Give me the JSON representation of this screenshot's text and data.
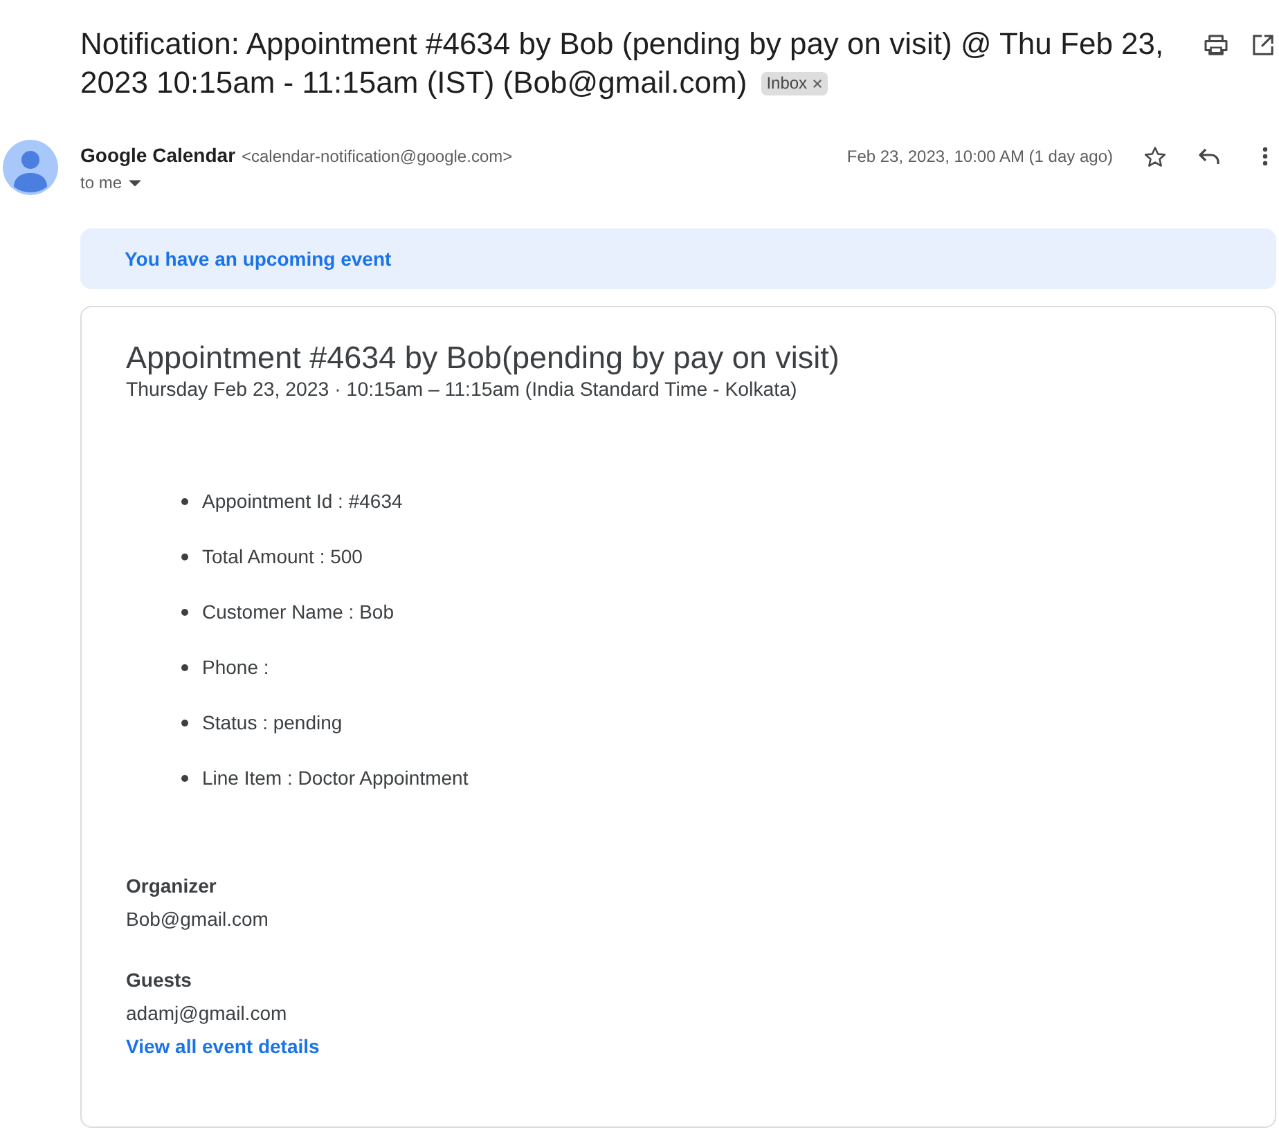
{
  "subject": {
    "title": "Notification: Appointment #4634 by Bob (pending by pay on visit) @ Thu Feb 23, 2023 10:15am - 11:15am (IST) (Bob@gmail.com)",
    "labels": [
      {
        "text": "Inbox"
      }
    ]
  },
  "message": {
    "sender_name": "Google Calendar",
    "sender_email": "<calendar-notification@google.com>",
    "recipient": "to me",
    "date": "Feb 23, 2023, 10:00 AM (1 day ago)",
    "starred": false
  },
  "banner": {
    "text": "You have an upcoming event"
  },
  "event": {
    "title": "Appointment #4634 by Bob(pending by pay on visit)",
    "when": "Thursday Feb 23, 2023 · 10:15am – 11:15am (India Standard Time - Kolkata)",
    "details": [
      "Appointment Id : #4634",
      "Total Amount : 500",
      "Customer Name : Bob",
      "Phone :",
      "Status : pending",
      "Line Item : Doctor Appointment"
    ],
    "organizer": {
      "label": "Organizer",
      "email": "Bob@gmail.com"
    },
    "guests": {
      "label": "Guests",
      "emails": [
        "adamj@gmail.com"
      ]
    },
    "link": "View all event details"
  }
}
